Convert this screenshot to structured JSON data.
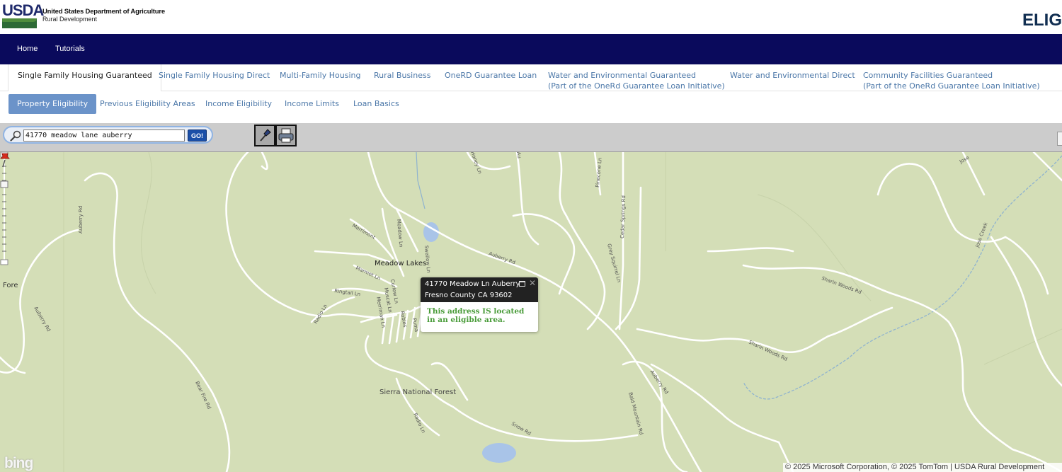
{
  "header": {
    "logo_text": "USDA",
    "department": "United States Department of Agriculture",
    "agency": "Rural Development",
    "title_fragment": "ELIG"
  },
  "topnav": {
    "items": [
      {
        "label": "Home"
      },
      {
        "label": "Tutorials"
      }
    ]
  },
  "program_tabs": [
    {
      "label": "Single Family Housing Guaranteed",
      "active": true
    },
    {
      "label": "Single Family Housing Direct"
    },
    {
      "label": "Multi-Family Housing"
    },
    {
      "label": "Rural Business"
    },
    {
      "label": "OneRD Guarantee Loan"
    },
    {
      "label": "Water and Environmental Guaranteed",
      "sub": "(Part of the OneRd Guarantee Loan Initiative)"
    },
    {
      "label": "Water and Environmental Direct"
    },
    {
      "label": "Community Facilities Guaranteed",
      "sub": "(Part of the OneRd Guarantee Loan Initiative)"
    }
  ],
  "sub_tabs": [
    {
      "label": "Property Eligibility",
      "active": true
    },
    {
      "label": "Previous Eligibility Areas"
    },
    {
      "label": "Income Eligibility"
    },
    {
      "label": "Income Limits"
    },
    {
      "label": "Loan Basics"
    }
  ],
  "toolbar": {
    "search_value": "41770 meadow lane auberry",
    "go_label": "GO!",
    "tools": [
      {
        "icon": "pushpin-tool-icon"
      },
      {
        "icon": "printer-icon"
      }
    ]
  },
  "map": {
    "place_labels": {
      "meadow_lakes": "Meadow Lakes",
      "sierra_national_forest": "Sierra National Forest",
      "fore": "Fore"
    },
    "road_labels": {
      "auberry_rd": "Auberry Rd",
      "auberry_rd_2": "Auberry Rd",
      "auberry_rd_3": "Auberry Rd",
      "auberry_rd_4": "Auberry Rd",
      "meadow_ln": "Meadow Ln",
      "merrimont": "Merrimont",
      "marmot_ln": "Marmot Ln",
      "ringtail_ln": "Ringtail Ln",
      "radio_ln": "Radio Ln",
      "radio_ln_2": "Radio Ln",
      "curlew_ln": "Curlew Ln",
      "muscat_ln": "Muscat Ln",
      "merriman_ln": "Merriman Ln",
      "robles": "Robles",
      "puma": "Puma",
      "swallow_ln": "Swallow Ln",
      "honey_ln": "Honey Ln",
      "pinecone_ln": "Pinecone Ln",
      "cedar_springs_rd": "Cedar Springs Rd",
      "grey_squirrel_ln": "Grey Squirrel Ln",
      "sharin_woods_rd": "Sharin Woods Rd",
      "sharin_woods_rd_2": "Sharin Woods Rd",
      "jose_creek": "Jose Creek",
      "jose": "Jose",
      "bear_fire_rd": "Bear Fire Rd",
      "snow_rd": "Snow Rd",
      "bald_mountain_rd": "Bald Mountain Rd",
      "au": "Au"
    },
    "popup": {
      "address_line1": "41770 Meadow Ln Auberry",
      "address_line2": "Fresno County CA 93602",
      "result": "This address IS located in an eligible area."
    },
    "copyright": "© 2025 Microsoft Corporation, © 2025 TomTom | USDA Rural Development",
    "bing_logo": "bing"
  },
  "colors": {
    "nav_bg": "#0a0a5c",
    "active_subtab": "#6b93c9",
    "link": "#4b77a8",
    "map_bg": "#d4deb7",
    "eligible_text": "#4a9c3a"
  }
}
